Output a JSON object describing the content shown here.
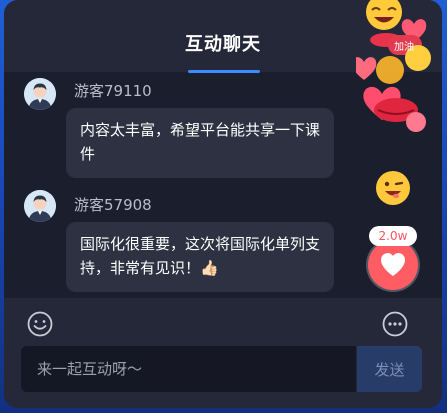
{
  "header": {
    "title": "互动聊天"
  },
  "messages": [
    {
      "username": "游客79110",
      "text": "内容太丰富，希望平台能共享一下课件"
    },
    {
      "username": "游客57908",
      "text": "国际化很重要，这次将国际化单列支持，非常有见识！",
      "emoji": "👍🏻"
    }
  ],
  "reactions": {
    "badge": "加油",
    "like_count": "2.0w"
  },
  "footer": {
    "input_placeholder": "来一起互动呀～",
    "send_label": "发送",
    "emoji_icon": "smiley-icon",
    "more_icon": "more-icon"
  },
  "colors": {
    "accent": "#3b8cff",
    "like": "#ff5d63",
    "panel": "#1b1e2c",
    "bubble": "#2d3142"
  }
}
